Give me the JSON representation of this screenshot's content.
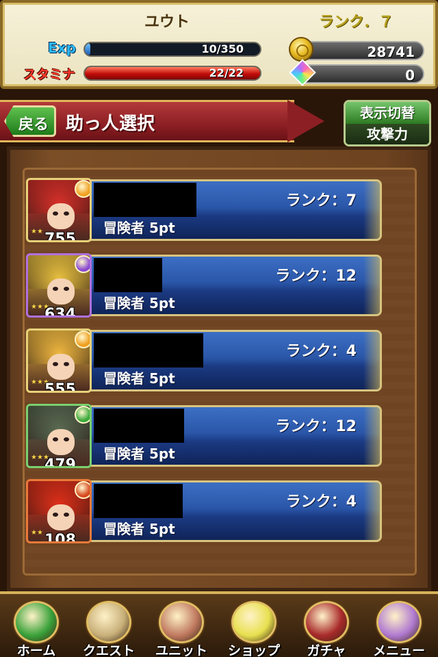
{
  "header": {
    "player_name": "ユウト",
    "rank_text": "ランク．７",
    "exp": {
      "label": "Exp",
      "text": "10/350",
      "fraction": 0.03
    },
    "stamina": {
      "label": "スタミナ",
      "text": "22/22",
      "fraction": 1.0
    },
    "coins": "28741",
    "gems": "0"
  },
  "titlebar": {
    "back_label": "戻る",
    "title": "助っ人選択",
    "toggle_top": "表示切替",
    "toggle_bottom": "攻撃力"
  },
  "helpers": [
    {
      "rank": "ランク：7",
      "role": "冒険者 5pt",
      "power": "755",
      "element": "fire",
      "element_color": "#f0a020",
      "hair_color": "#d8302a",
      "frame_color": "#e8d27a"
    },
    {
      "rank": "ランク：12",
      "role": "冒険者 5pt",
      "power": "634",
      "element": "dark",
      "element_color": "#8a4ad0",
      "hair_color": "#e8c040",
      "frame_color": "#b070e0"
    },
    {
      "rank": "ランク：4",
      "role": "冒険者 5pt",
      "power": "555",
      "element": "fire",
      "element_color": "#f0a020",
      "hair_color": "#f0b840",
      "frame_color": "#e8d27a"
    },
    {
      "rank": "ランク：12",
      "role": "冒険者 5pt",
      "power": "479",
      "element": "wind",
      "element_color": "#3caa3c",
      "hair_color": "#5a6a52",
      "frame_color": "#7ad070"
    },
    {
      "rank": "ランク：4",
      "role": "冒険者 5pt",
      "power": "108",
      "element": "fire",
      "element_color": "#d84a20",
      "hair_color": "#e0301a",
      "frame_color": "#e87a3a"
    }
  ],
  "nav": [
    {
      "label": "ホーム",
      "icon": "flag-icon",
      "color": "#3aa23a"
    },
    {
      "label": "クエスト",
      "icon": "map-icon",
      "color": "#c9b07a"
    },
    {
      "label": "ユニット",
      "icon": "staff-icon",
      "color": "#c07a60"
    },
    {
      "label": "ショップ",
      "icon": "crystal-icon",
      "color": "#e8e050"
    },
    {
      "label": "ガチャ",
      "icon": "book-icon",
      "color": "#a82a2a"
    },
    {
      "label": "メニュー",
      "icon": "quill-icon",
      "color": "#b07ad0"
    }
  ]
}
